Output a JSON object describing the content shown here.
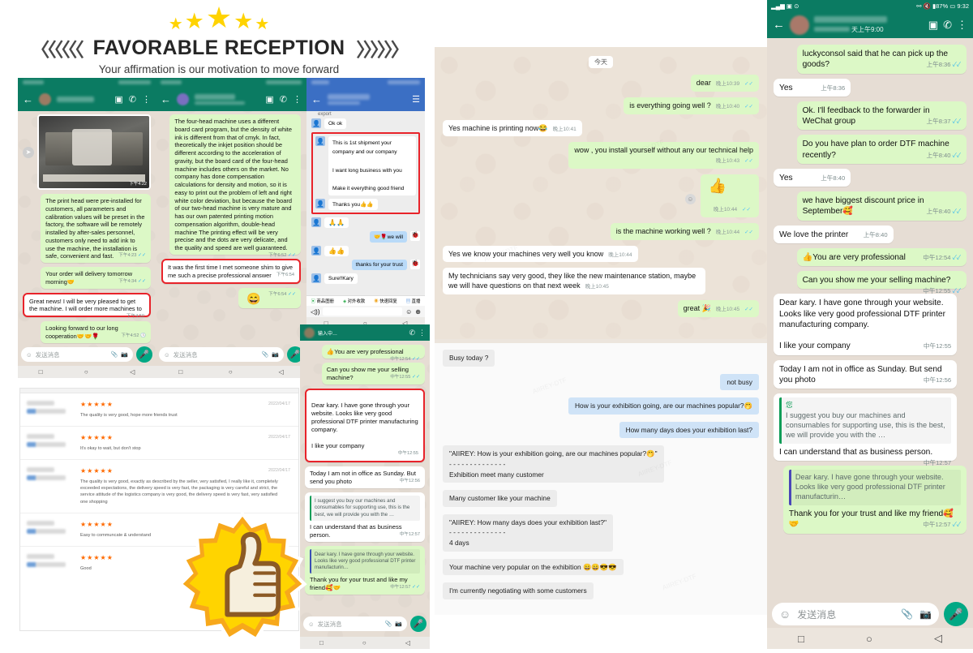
{
  "header": {
    "title": "FAVORABLE RECEPTION",
    "subtitle": "Your affirmation is our motivation to move forward",
    "chev_left": "〈〈〈〈〈〈",
    "chev_right": "〉〉〉〉〉〉",
    "star_glyph": "★"
  },
  "panel1": {
    "name": "whatsapp-chat-1",
    "input_placeholder": "发送消息",
    "messages": [
      {
        "side": "out",
        "text": "The print head were pre-installed for customers, all parameters and calibration values will be preset in the factory, the software will be remotely installed by after-sales personnel, customers only need to add ink to use the machine, the installation is safe, convenient and fast.",
        "time": "下午4:23",
        "ticks": "✓✓"
      },
      {
        "side": "out",
        "text": "Your order will delivery tomorrow morning🤝",
        "time": "下午4:34",
        "ticks": "✓✓"
      },
      {
        "side": "in",
        "text": "Great news! I will be very pleased to get the machine. I will order more machines to",
        "time": "下午4:50",
        "ticks": "",
        "highlight": true
      },
      {
        "side": "out",
        "text": "Looking forward to our long cooperation🤝🤝🌹",
        "time": "下午4:52",
        "ticks": "🕒"
      }
    ],
    "image_time": "下午4:22"
  },
  "panel2": {
    "name": "whatsapp-chat-2",
    "input_placeholder": "发送消息",
    "messages": [
      {
        "side": "out",
        "text": "The four-head machine uses a different board card program, but the density of white ink is different from that of cmyk. In fact, theoretically the inkjet position should be different according to the acceleration of gravity, but the board card of the four-head machine includes others on the market. No company has done compensation calculations for density and motion, so it is easy to print out the problem of left and right white color deviation, but because the board of our two-head machine is very mature and has our own patented printing motion compensation algorithm, double-head machine The printing effect will be very precise and the dots are very delicate, and the quality and speed are well guaranteed.",
        "time": "下午6:52",
        "ticks": "✓✓"
      },
      {
        "side": "in",
        "text": "It was the first time I met someone shim to give me such a precise professional answer",
        "time": "下午6:54",
        "ticks": "",
        "highlight": true
      },
      {
        "side": "out",
        "text": "😄",
        "time": "下午6:54",
        "ticks": "✓✓"
      }
    ]
  },
  "panel3": {
    "name": "wechat-chat-blue",
    "header_crumb": "export",
    "messages": [
      {
        "side": "in",
        "text": "Ok ok"
      },
      {
        "side": "in",
        "text": "This is 1st shipment your company and our company\n\nI want long business with you\n\nMake it everything good friend",
        "highlight": true
      },
      {
        "side": "in",
        "text": "Thanks you👍👍",
        "highlight": true
      },
      {
        "side": "in",
        "text": "🙏🙏"
      },
      {
        "side": "out",
        "text": "🤝🌹we will"
      },
      {
        "side": "in",
        "text": "👍👍"
      },
      {
        "side": "out",
        "text": "thanks for your trust"
      },
      {
        "side": "in",
        "text": "Sure‼Kary"
      }
    ],
    "toolbar": [
      "商品图册",
      "对外收款",
      "快速回复",
      "直播"
    ],
    "typing_hint": "输入中…"
  },
  "panel4": {
    "name": "whatsapp-chat-4",
    "input_placeholder": "发送消息",
    "messages": [
      {
        "side": "out",
        "text": "👍You are very professional",
        "time": "中午12:54",
        "ticks": "✓✓"
      },
      {
        "side": "out",
        "text": "Can you show me your selling machine?",
        "time": "中午12:55",
        "ticks": "✓✓"
      },
      {
        "side": "in",
        "text": "Dear kary.  I have gone through your website. Looks like very good professional DTF printer manufacturing company.\n\nI like your company",
        "time": "中午12:55",
        "ticks": "",
        "highlight": true
      },
      {
        "side": "in",
        "text": "Today I am not in office as Sunday. But send you photo",
        "time": "中午12:56",
        "ticks": ""
      },
      {
        "side": "in",
        "quote": "I suggest you buy our machines and consumables for supporting use, this is the best, we will provide you with the …",
        "text": "I can understand that as business person.",
        "time": "中午12:57",
        "ticks": ""
      },
      {
        "side": "out",
        "quote": "Dear kary.  I have gone through your website. Looks like very good professional DTF printer manufacturin…",
        "text": "Thank you for your trust and like my friend🥰🤝",
        "time": "中午12:57",
        "ticks": "✓✓"
      }
    ]
  },
  "reviews": {
    "name": "product-reviews",
    "stars": "★★★★★",
    "items": [
      {
        "date": "2022/04/17",
        "text": "The quality is very good, hope more friends trust"
      },
      {
        "date": "2022/04/17",
        "text": "It's okay to wait, but don't stop"
      },
      {
        "date": "2022/04/17",
        "text": "The quality is very good, exactly as described by the seller, very satisfied, I really like it, completely exceeded expectations, the delivery speed is very fast, the packaging is very careful and strict, the service attitude of the logistics company is very good, the delivery speed is very fast, very satisfied one shopping"
      },
      {
        "date": "",
        "text": "Easy to communcate & understand"
      },
      {
        "date": "",
        "text": "Good"
      }
    ]
  },
  "midchat": {
    "name": "whatsapp-chat-main",
    "day_label": "今天",
    "top_messages": [
      {
        "side": "out",
        "text": "dear",
        "time": "晚上10:39",
        "ticks": "✓✓"
      },
      {
        "side": "out",
        "text": "is everything going well ?",
        "time": "晚上10:40",
        "ticks": "✓✓"
      },
      {
        "side": "in",
        "text": "Yes machine is printing now😂",
        "time": "晚上10:41",
        "ticks": ""
      },
      {
        "side": "out",
        "text": "wow , you install yourself without any our technical help",
        "time": "晚上10:43",
        "ticks": "✓✓"
      },
      {
        "side": "out",
        "text": "👍",
        "time": "晚上10:44",
        "ticks": "✓✓"
      },
      {
        "side": "out",
        "text": "is the machine working well ?",
        "time": "晚上10:44",
        "ticks": "✓✓"
      },
      {
        "side": "in",
        "text": "Yes we know your machines very well you know",
        "time": "晚上10:44",
        "ticks": ""
      },
      {
        "side": "in",
        "text": "My technicians say very good, they like the new maintenance station, maybe we will have questions on that next week",
        "time": "晚上10:45",
        "ticks": ""
      },
      {
        "side": "out",
        "text": "great 🎉",
        "time": "晚上10:45",
        "ticks": "✓✓"
      }
    ],
    "bottom_messages": [
      {
        "side": "in",
        "text": "Busy today ?"
      },
      {
        "side": "out",
        "text": "not busy"
      },
      {
        "side": "out",
        "text": "How is your exhibition going, are our machines popular?🤭"
      },
      {
        "side": "out",
        "text": "How many days does your exhibition last?"
      },
      {
        "side": "in",
        "text": "\"AIIREY: How is your exhibition going, are our machines popular?🤭\"\n- - - - - - - - - - - - - -\nExhibition meet many customer"
      },
      {
        "side": "in",
        "text": "Many customer like your machine"
      },
      {
        "side": "in",
        "text": "\"AIIREY: How many days does your exhibition last?\"\n- - - - - - - - - - - - - -\n4 days"
      },
      {
        "side": "in",
        "text": "Your machine very popular on the exhibition 😄😄😎😎"
      },
      {
        "side": "in",
        "text": "I'm currently negotiating with some customers"
      }
    ],
    "watermark": "AIIREY-DTF"
  },
  "rightchat": {
    "name": "whatsapp-chat-right",
    "status_time": "9:32",
    "status_battery": "87%",
    "last_seen": "天上午9:00",
    "input_placeholder": "发送消息",
    "messages": [
      {
        "side": "out",
        "text": "luckyconsol said that he can pick up the goods?",
        "time": "上午8:36",
        "ticks": "✓✓"
      },
      {
        "side": "in",
        "text": "Yes",
        "time": "上午8:36",
        "ticks": ""
      },
      {
        "side": "out",
        "text": "Ok. I'll feedback to the forwarder in WeChat group",
        "time": "上午8:37",
        "ticks": "✓✓"
      },
      {
        "side": "out",
        "text": "Do you have plan to order DTF machine recently?",
        "time": "上午8:40",
        "ticks": "✓✓"
      },
      {
        "side": "in",
        "text": "Yes",
        "time": "上午8:40",
        "ticks": ""
      },
      {
        "side": "out",
        "text": "we have biggest discount price in September🥰",
        "time": "上午8:40",
        "ticks": "✓✓"
      },
      {
        "side": "in",
        "text": "We love the printer",
        "time": "上午8:40",
        "ticks": ""
      },
      {
        "side": "out",
        "text": "👍You are very professional",
        "time": "中午12:54",
        "ticks": "✓✓"
      },
      {
        "side": "out",
        "text": "Can you show me your selling machine?",
        "time": "中午12:55",
        "ticks": "✓✓"
      },
      {
        "side": "in",
        "text": "Dear kary.  I have gone through your website. Looks like very good professional DTF printer manufacturing company.\n\nI like your company",
        "time": "中午12:55",
        "ticks": ""
      },
      {
        "side": "in",
        "text": "Today I am not in office as Sunday. But send you photo",
        "time": "中午12:56",
        "ticks": ""
      },
      {
        "side": "in",
        "quote_title": "您",
        "quote": "I suggest you buy our machines and consumables for supporting use, this is the best, we will provide you with the …",
        "text": "I can understand that as business person.",
        "time": "中午12:57",
        "ticks": ""
      },
      {
        "side": "out",
        "quote": "Dear kary.  I have gone through your website. Looks like very good professional DTF printer manufacturin…",
        "text": "Thank you for your trust and like my friend🥰🤝",
        "time": "中午12:57",
        "ticks": "✓✓"
      }
    ]
  },
  "icons": {
    "back": "←",
    "video": "▣",
    "phone": "✆",
    "menu": "⋮",
    "emoji": "☺",
    "clip": "📎",
    "camera": "📷",
    "mic": "🎤",
    "nav_square": "□",
    "nav_circle": "○",
    "nav_back": "◁",
    "list": "☰"
  },
  "colors": {
    "wa_green": "#0b7b62",
    "bubble_out": "#dcf8c6",
    "bubble_in": "#ffffff",
    "highlight_red": "#e8232a",
    "wechat_blue": "#3b6fc4",
    "star_yellow": "#FFD300",
    "review_star": "#ff6a00"
  }
}
